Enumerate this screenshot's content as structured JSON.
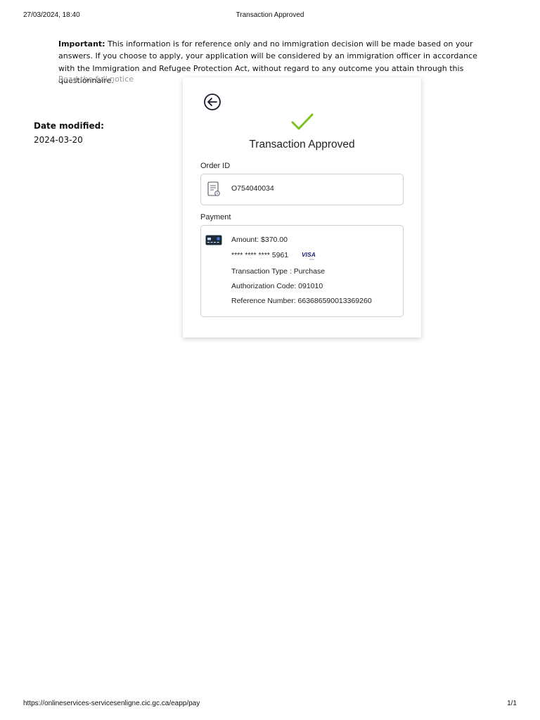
{
  "print_header": {
    "datetime": "27/03/2024, 18:40",
    "title": "Transaction Approved"
  },
  "print_footer": {
    "url": "https://onlineservices-servicesenligne.cic.gc.ca/eapp/pay",
    "page": "1/1"
  },
  "notice": {
    "label": "Important:",
    "text": " This information is for reference only and no immigration decision will be made based on your answers. If you choose to apply, your application will be considered by an immigration officer in accordance with the Immigration and Refugee Protection Act, without regard to any outcome you attain through this questionnaire.",
    "link": "Read the full notice"
  },
  "date_modified": {
    "label": "Date modified:",
    "value": "2024-03-20"
  },
  "transaction": {
    "title": "Transaction Approved",
    "order_label": "Order ID",
    "order_id": "O754040034",
    "payment_label": "Payment",
    "amount": "Amount: $370.00",
    "card_number": "**** **** **** 5961",
    "card_brand": "VISA",
    "type": "Transaction Type : Purchase",
    "auth_code": "Authorization Code: 091010",
    "reference": "Reference Number: 663686590013369260"
  },
  "icons": {
    "back": "arrow-left-circle-icon",
    "check": "checkmark-icon",
    "order": "receipt-icon",
    "card": "credit-card-icon",
    "brand": "visa-logo"
  },
  "colors": {
    "check_green": "#7cc21c",
    "visa_blue": "#1a1f71",
    "link_grey": "#999999"
  }
}
